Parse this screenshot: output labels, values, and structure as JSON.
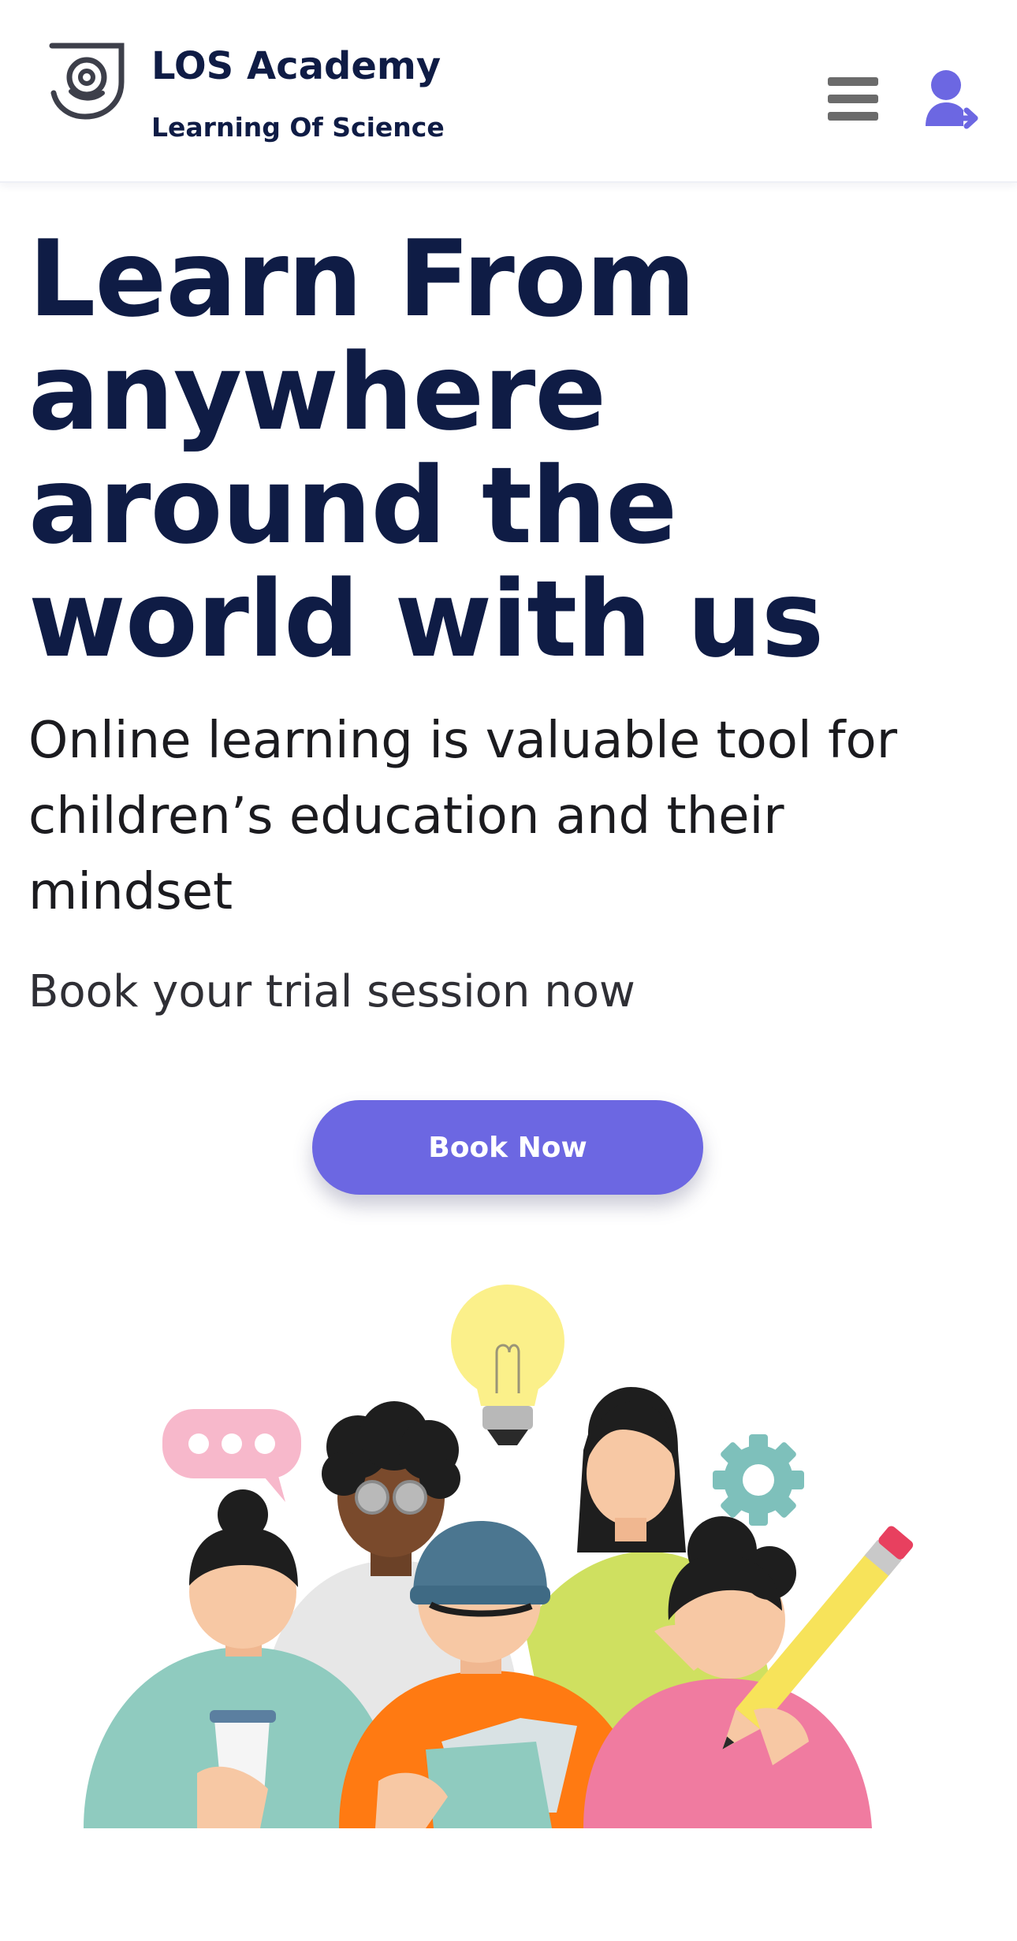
{
  "header": {
    "brand_name": "LOS Academy",
    "brand_tagline": "Learning Of Science",
    "icons": {
      "logo": "los-academy-logo-icon",
      "menu": "hamburger-menu-icon",
      "user": "user-login-icon"
    }
  },
  "hero": {
    "title": "Learn From anywhere around the world with us",
    "subtitle": "Online learning is valuable tool for children’s education and their mindset",
    "cta_text": "Book your trial session now",
    "book_button_label": "Book Now"
  },
  "colors": {
    "brand_dark": "#0f1c45",
    "accent": "#6c67e2",
    "menu_icon": "#6b6b6b"
  }
}
